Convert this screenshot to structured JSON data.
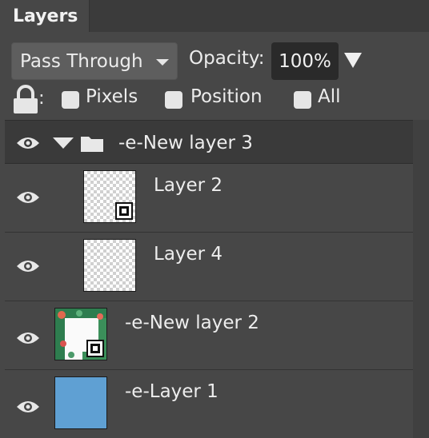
{
  "panel": {
    "tab_title": "Layers"
  },
  "controls": {
    "blend_mode": "Pass Through",
    "opacity_label": "Opacity:",
    "opacity_value": "100%",
    "lock_colon": ":",
    "lock_options": [
      {
        "label": "Pixels",
        "checked": false
      },
      {
        "label": "Position",
        "checked": false
      },
      {
        "label": "All",
        "checked": false
      }
    ]
  },
  "layers": [
    {
      "name": "-e-New layer 3",
      "kind": "group",
      "expanded": true,
      "visible": true
    },
    {
      "name": "Layer 2",
      "kind": "smart-object",
      "thumbnail": "transparent",
      "visible": true
    },
    {
      "name": "Layer 4",
      "kind": "layer",
      "thumbnail": "transparent",
      "visible": true
    },
    {
      "name": "-e-New layer 2",
      "kind": "smart-object",
      "thumbnail": "floral-wreath",
      "visible": true
    },
    {
      "name": "-e-Layer 1",
      "kind": "layer",
      "thumbnail": "solid",
      "thumbnail_color": "#5fa0d3",
      "visible": true
    }
  ],
  "colors": {
    "panel_bg": "#474747",
    "group_row_bg": "#3a3a3a",
    "text": "#ededed",
    "layer1_fill": "#5fa0d3"
  }
}
